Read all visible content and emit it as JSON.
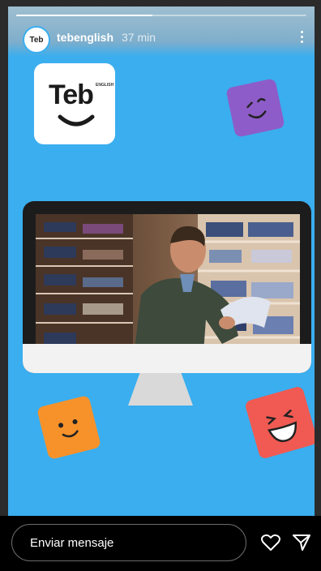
{
  "story": {
    "username": "tebenglish",
    "time": "37 min",
    "progress": 0.47,
    "avatar_text": "Teb"
  },
  "logo": {
    "text": "Teb",
    "sup": "ENGLISH"
  },
  "stickers": [
    {
      "name": "wink-sticker",
      "color": "#8e5cc8"
    },
    {
      "name": "smile-sticker-orange",
      "color": "#f7922a"
    },
    {
      "name": "laugh-sticker-red",
      "color": "#f05a52"
    }
  ],
  "reply": {
    "placeholder": "Enviar mensaje"
  },
  "icons": {
    "like": "heart-icon",
    "share": "send-icon",
    "more": "more-vertical-icon"
  },
  "colors": {
    "background": "#3aaeef",
    "monitor": "#1c1c1c"
  }
}
